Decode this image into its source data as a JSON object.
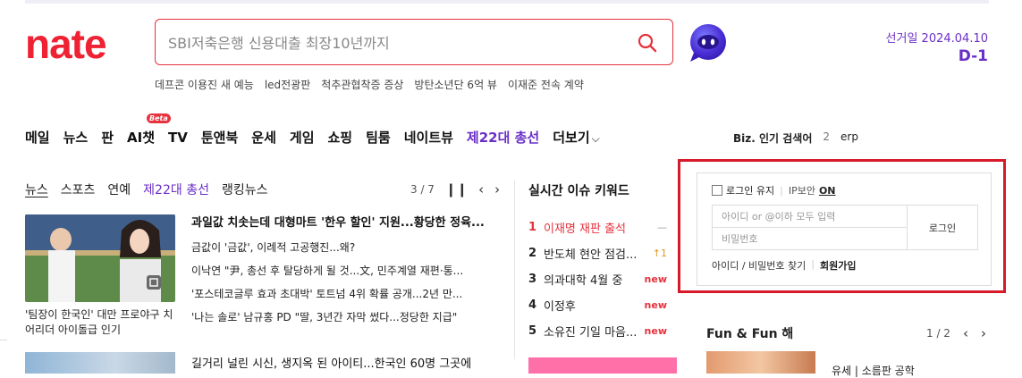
{
  "brand": {
    "logo_text": "nate",
    "accent_color": "#e5323d",
    "purple_color": "#6a2fc6"
  },
  "search": {
    "placeholder": "SBI저축은행 신용대출 최장10년까지",
    "icon": "search-icon"
  },
  "ai_bot": {
    "icon": "chat-bot-icon"
  },
  "election_banner": {
    "label": "선거일 2024.04.10",
    "dday": "D-1"
  },
  "trending_links": [
    "데프콘 이용진 새 예능",
    "led전광판",
    "척추관협착증 증상",
    "방탄소년단 6억 뷰",
    "이재준 전속 계약"
  ],
  "gnb": {
    "items": [
      {
        "label": "메일"
      },
      {
        "label": "뉴스"
      },
      {
        "label": "판"
      },
      {
        "label": "AI챗",
        "badge": "Beta"
      },
      {
        "label": "TV"
      },
      {
        "label": "툰앤북"
      },
      {
        "label": "운세"
      },
      {
        "label": "게임"
      },
      {
        "label": "쇼핑"
      },
      {
        "label": "팀룸"
      },
      {
        "label": "네이트뷰"
      },
      {
        "label": "제22대 총선",
        "highlight": true
      },
      {
        "label": "더보기"
      }
    ]
  },
  "biz_search": {
    "title": "Biz. 인기 검색어",
    "rank": "2",
    "keyword": "erp"
  },
  "news": {
    "tabs": [
      "뉴스",
      "스포츠",
      "연예",
      "제22대 총선",
      "랭킹뉴스"
    ],
    "pager": "3 / 7",
    "thumb_caption": "'팀장이 한국인' 대만 프로야구 치어리더 아이돌급 인기",
    "headline": "과일값 치솟는데 대형마트 '한우 할인' 지원...황당한 정육...",
    "sub_headlines": [
      "금값이 '금값', 이례적 고공행진...왜?",
      "이낙연 \"尹, 총선 후 탈당하게 될 것...文, 민주계열 재편·통...",
      "'포스테코글루 효과 초대박' 토트넘 4위 확률 공개...2년 만...",
      "'나는 솔로' 남규홍 PD \"딸, 3년간 자막 썼다...정당한 지급\""
    ],
    "bottom_headline": "길거리 널린 시신, 생지옥 된 아이티...한국인 60명 그곳에"
  },
  "realtime": {
    "title": "실시간 이슈 키워드",
    "items": [
      {
        "rank": "1",
        "keyword": "이재명 재판 출석",
        "badge": "—",
        "badge_type": "flat"
      },
      {
        "rank": "2",
        "keyword": "반도체 현안 점검...",
        "badge": "↑1",
        "badge_type": "up"
      },
      {
        "rank": "3",
        "keyword": "의과대학 4월 중",
        "badge": "new",
        "badge_type": "new"
      },
      {
        "rank": "4",
        "keyword": "이정후",
        "badge": "new",
        "badge_type": "new"
      },
      {
        "rank": "5",
        "keyword": "소유진 기일 마음...",
        "badge": "new",
        "badge_type": "new"
      }
    ]
  },
  "login": {
    "keep_login": "로그인 유지",
    "ip_security": "IP보안",
    "ip_on": "ON",
    "id_placeholder": "아이디 or @이하 모두 입력",
    "pw_placeholder": "비밀번호",
    "login_button": "로그인",
    "find_link": "아이디 / 비밀번호 찾기",
    "signup_link": "회원가입"
  },
  "fun": {
    "title": "Fun & Fun 해",
    "pager": "1 / 2",
    "item_text": "유세 | 소름판 공학"
  }
}
